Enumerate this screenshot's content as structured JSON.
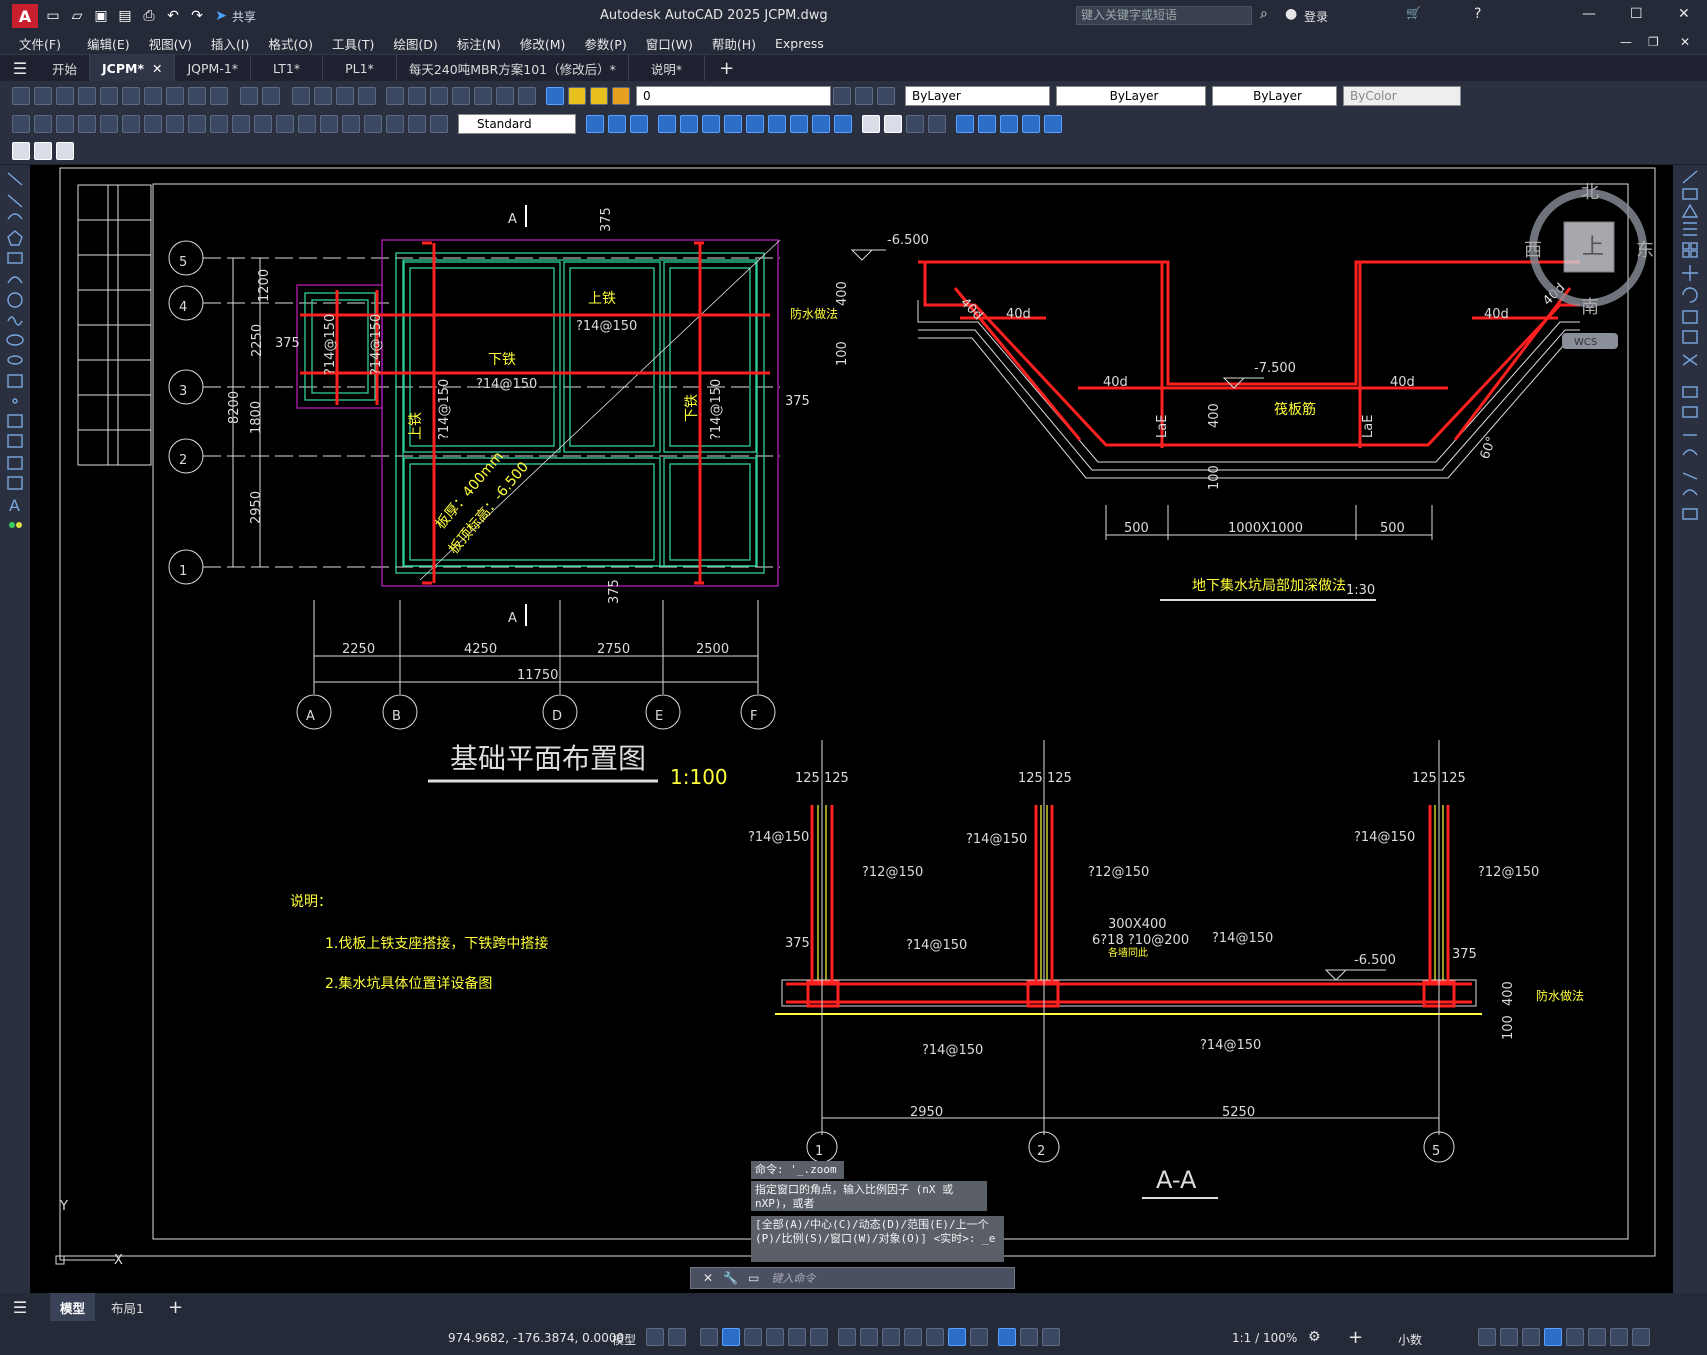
{
  "app": {
    "title": "Autodesk AutoCAD 2025    JCPM.dwg",
    "share_label": "共享",
    "search_placeholder": "键入关键字或短语",
    "login_label": "登录"
  },
  "menu": [
    "文件(F)",
    "编辑(E)",
    "视图(V)",
    "插入(I)",
    "格式(O)",
    "工具(T)",
    "绘图(D)",
    "标注(N)",
    "修改(M)",
    "参数(P)",
    "窗口(W)",
    "帮助(H)",
    "Express"
  ],
  "file_tabs": [
    "开始",
    "JCPM*",
    "JQPM-1*",
    "LT1*",
    "PL1*",
    "每天240吨MBR方案101（修改后）*",
    "说明*"
  ],
  "active_tab": "JCPM*",
  "properties": {
    "layer": "0",
    "text_style": "Standard",
    "color": "ByLayer",
    "linetype": "ByLayer",
    "lineweight": "ByLayer",
    "plot_style": "ByColor"
  },
  "drawing": {
    "plan_title": "基础平面布置图",
    "plan_scale": "1:100",
    "pit_title": "地下集水坑局部加深做法",
    "pit_scale": "1:30",
    "section_title": "A-A",
    "section_marker": "A",
    "notes_title": "说明：",
    "notes": [
      "1.伐板上铁支座搭接，下铁跨中搭接",
      "2.集水坑具体位置详设备图"
    ],
    "row_axes": [
      "5",
      "4",
      "3",
      "2",
      "1"
    ],
    "col_axes": [
      "A",
      "B",
      "D",
      "E",
      "F"
    ],
    "row_dims": [
      "1200",
      "2250",
      "1800",
      "2950"
    ],
    "row_total": "8200",
    "col_dims": [
      "2250",
      "4250",
      "2750",
      "2500"
    ],
    "col_total": "11750",
    "rebar_top": "上铁",
    "rebar_bottom": "下铁",
    "rebar_spec": "?14@150",
    "rebar_spec2": "?12@150",
    "dim_375": "375",
    "slab_note1": "板厚：400mm",
    "slab_note2": "板顶标高：-6.500",
    "waterproof": "防水做法",
    "pit": {
      "elev_top": "-6.500",
      "elev_bottom": "-7.500",
      "d40": "40d",
      "lae": "LaE",
      "raft_rebar": "筏板筋",
      "dim400": "400",
      "dim100": "100",
      "angle": "60°",
      "bottom_dims": [
        "500",
        "1000X1000",
        "500"
      ]
    },
    "section": {
      "wall_dims": "125 125",
      "beam": "300X400",
      "beam_rebar": "6?18  ?10@200",
      "beam_note": "各墙同此",
      "elev": "-6.500",
      "dims": [
        "2950",
        "5250"
      ],
      "axes": [
        "1",
        "2",
        "5"
      ]
    },
    "viewcube": {
      "north": "北",
      "south": "南",
      "east": "东",
      "west": "西",
      "top": "上",
      "wcs": "WCS"
    }
  },
  "command": {
    "line1": "命令: '_.zoom",
    "line2": "指定窗口的角点，输入比例因子 (nX 或 nXP)，或者",
    "line3": "[全部(A)/中心(C)/动态(D)/范围(E)/上一个(P)/比例(S)/窗口(W)/对象(O)] <实时>: _e",
    "placeholder": "键入命令"
  },
  "layout_tabs": [
    "模型",
    "布局1"
  ],
  "status": {
    "coords": "974.9682, -176.3874, 0.0000",
    "space": "模型",
    "scale": "1:1 / 100%",
    "units": "小数"
  },
  "colors": {
    "accent": "#2c6dc7",
    "canvas": "#000000",
    "rebar": "#ff2020",
    "slab": "#30d0a0",
    "text_yellow": "#ffff3a"
  }
}
